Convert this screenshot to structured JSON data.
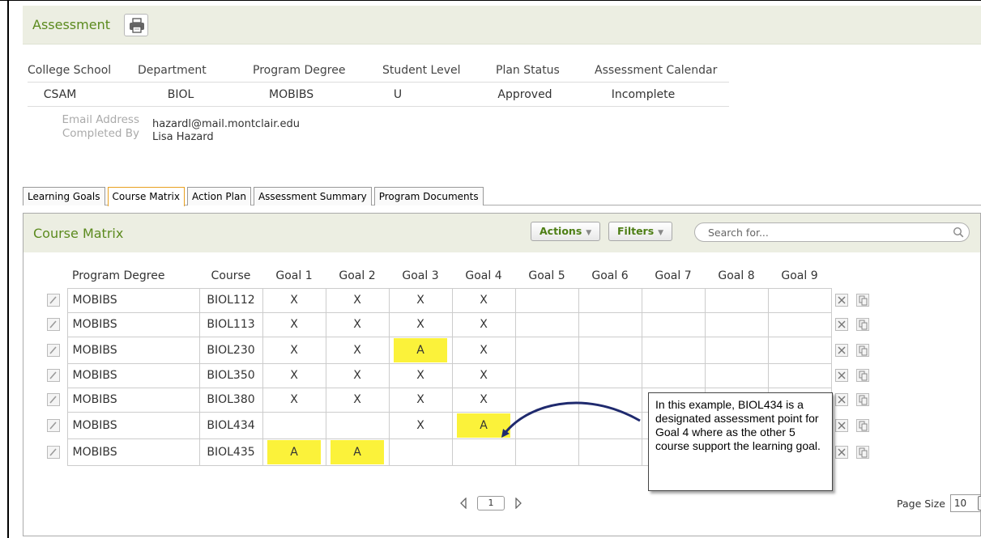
{
  "assessment": {
    "title": "Assessment",
    "info_headers": [
      "College School",
      "Department",
      "Program Degree",
      "Student Level",
      "Plan Status",
      "Assessment Calendar"
    ],
    "info_values": [
      "CSAM",
      "BIOL",
      "MOBIBS",
      "U",
      "Approved",
      "Incomplete"
    ],
    "email_label": "Email Address",
    "email_value": "hazardl@mail.montclair.edu",
    "completed_label": "Completed By",
    "completed_value": "Lisa Hazard"
  },
  "tabs": [
    "Learning Goals",
    "Course Matrix",
    "Action Plan",
    "Assessment Summary",
    "Program Documents"
  ],
  "active_tab": "Course Matrix",
  "matrix": {
    "title": "Course Matrix",
    "actions_label": "Actions",
    "filters_label": "Filters",
    "search_placeholder": "Search for...",
    "columns": [
      "Program Degree",
      "Course",
      "Goal 1",
      "Goal 2",
      "Goal 3",
      "Goal 4",
      "Goal 5",
      "Goal 6",
      "Goal 7",
      "Goal 8",
      "Goal 9"
    ],
    "rows": [
      {
        "program": "MOBIBS",
        "course": "BIOL112",
        "goals": [
          "X",
          "X",
          "X",
          "X",
          "",
          "",
          "",
          "",
          ""
        ]
      },
      {
        "program": "MOBIBS",
        "course": "BIOL113",
        "goals": [
          "X",
          "X",
          "X",
          "X",
          "",
          "",
          "",
          "",
          ""
        ]
      },
      {
        "program": "MOBIBS",
        "course": "BIOL230",
        "goals": [
          "X",
          "X",
          "A",
          "X",
          "",
          "",
          "",
          "",
          ""
        ]
      },
      {
        "program": "MOBIBS",
        "course": "BIOL350",
        "goals": [
          "X",
          "X",
          "X",
          "X",
          "",
          "",
          "",
          "",
          ""
        ]
      },
      {
        "program": "MOBIBS",
        "course": "BIOL380",
        "goals": [
          "X",
          "X",
          "X",
          "X",
          "",
          "",
          "",
          "",
          ""
        ]
      },
      {
        "program": "MOBIBS",
        "course": "BIOL434",
        "goals": [
          "",
          "",
          "X",
          "A",
          "",
          "",
          "",
          "",
          ""
        ]
      },
      {
        "program": "MOBIBS",
        "course": "BIOL435",
        "goals": [
          "A",
          "A",
          "",
          "",
          "",
          "",
          "",
          "",
          ""
        ]
      }
    ],
    "highlight_value": "A",
    "highlight_color": "#fbf23a",
    "current_page": "1",
    "page_size_label": "Page Size",
    "page_size_value": "10"
  },
  "callout_text": "In this example, BIOL434 is a designated assessment point for Goal 4 where as the other 5 course support the learning goal.",
  "colors": {
    "accent_green": "#5b8a1e",
    "header_bg": "#eceee2",
    "active_tab_border": "#e8a020",
    "arrow": "#1f2a6e"
  }
}
